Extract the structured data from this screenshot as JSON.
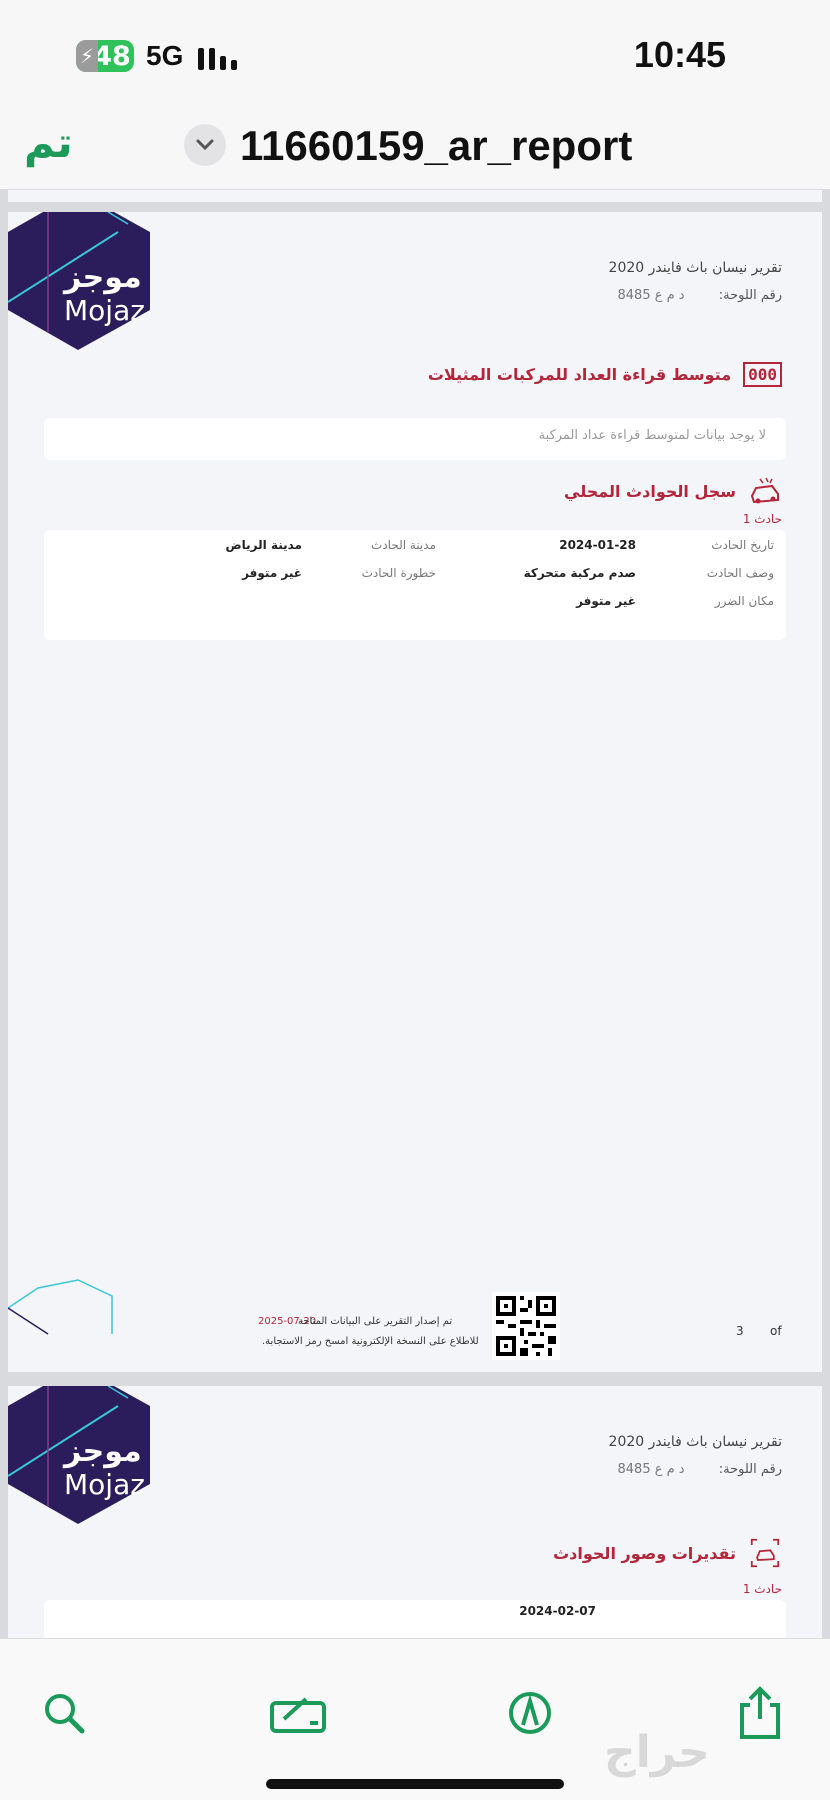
{
  "status_bar": {
    "battery": "48",
    "network": "5G",
    "time": "10:45"
  },
  "nav": {
    "done_label": "تم",
    "document_title": "11660159_ar_report"
  },
  "report": {
    "logo_ar": "موجز",
    "logo_en": "Mojaz",
    "vehicle_title": "تقرير نيسان باث فايندر 2020",
    "plate_label": "رقم اللوحة:",
    "plate_value": "د م ع 8485"
  },
  "page1": {
    "odometer_section_title": "متوسط قراءة العداد للمركبات المثيلات",
    "odometer_icon_text": "000",
    "odometer_no_data": "لا يوجد بيانات لمتوسط قراءة عداد المركبة",
    "accidents_section_title": "سجل الحوادث المحلي",
    "accident_label": "حادث 1",
    "accident_fields": {
      "date_label": "تاريخ الحادث",
      "date_value": "2024-01-28",
      "city_label": "مدينة الحادث",
      "city_value": "مدينة الرياض",
      "desc_label": "وصف الحادث",
      "desc_value": "صدم مركبة متحركة",
      "severity_label": "خطورة الحادث",
      "severity_value": "غير متوفر",
      "damage_label": "مكان الضرر",
      "damage_value": "غير متوفر"
    },
    "footer": {
      "issued_text": "تم إصدار التقرير على البيانات المتاحة",
      "issued_date": "2025-07-20",
      "scan_text": "للاطلاع على النسخة الإلكترونية امسح رمز الاستجابة.",
      "page_number": "3",
      "page_of": "of"
    }
  },
  "page2": {
    "estimates_section_title": "تقديرات وصور الحوادث",
    "accident_label": "حادث 1",
    "partial_date": "2024-02-07"
  },
  "toolbar": {
    "buttons": [
      "search-icon",
      "markup-icon",
      "pen-icon",
      "share-icon"
    ]
  },
  "watermark": "حراج",
  "colors": {
    "accent_green": "#1c9a5a",
    "brand_red": "#b3263a",
    "logo_navy": "#2b1d5c"
  }
}
